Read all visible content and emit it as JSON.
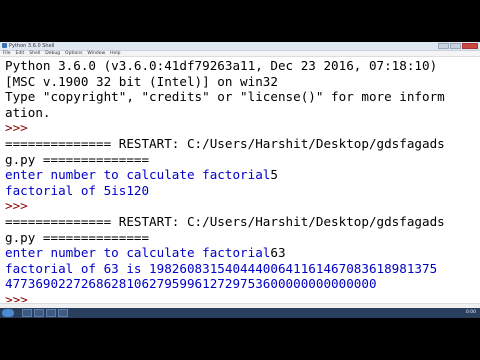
{
  "window": {
    "title": "Python 3.6.0 Shell",
    "menu": [
      "File",
      "Edit",
      "Shell",
      "Debug",
      "Options",
      "Window",
      "Help"
    ]
  },
  "shell": {
    "lines": [
      "Python 3.6.0 (v3.6.0:41df79263a11, Dec 23 2016, 07:18:10)",
      "[MSC v.1900 32 bit (Intel)] on win32",
      "Type \"copyright\", \"credits\" or \"license()\" for more inform",
      "ation.",
      ">>> ",
      "============== RESTART: C:/Users/Harshit/Desktop/gdsfagads",
      "g.py ==============",
      "enter number to calculate factorial",
      "factorial of 5is120",
      ">>> ",
      "============== RESTART: C:/Users/Harshit/Desktop/gdsfagads",
      "g.py ==============",
      "enter number to calculate factorial",
      "factorial of 63 is 19826083154044400641161467083618981375",
      "4773690227268628106279599612729753600000000000000",
      ">>> "
    ],
    "input_1": "5",
    "input_2": "63"
  },
  "taskbar": {
    "clock": "0:00"
  }
}
